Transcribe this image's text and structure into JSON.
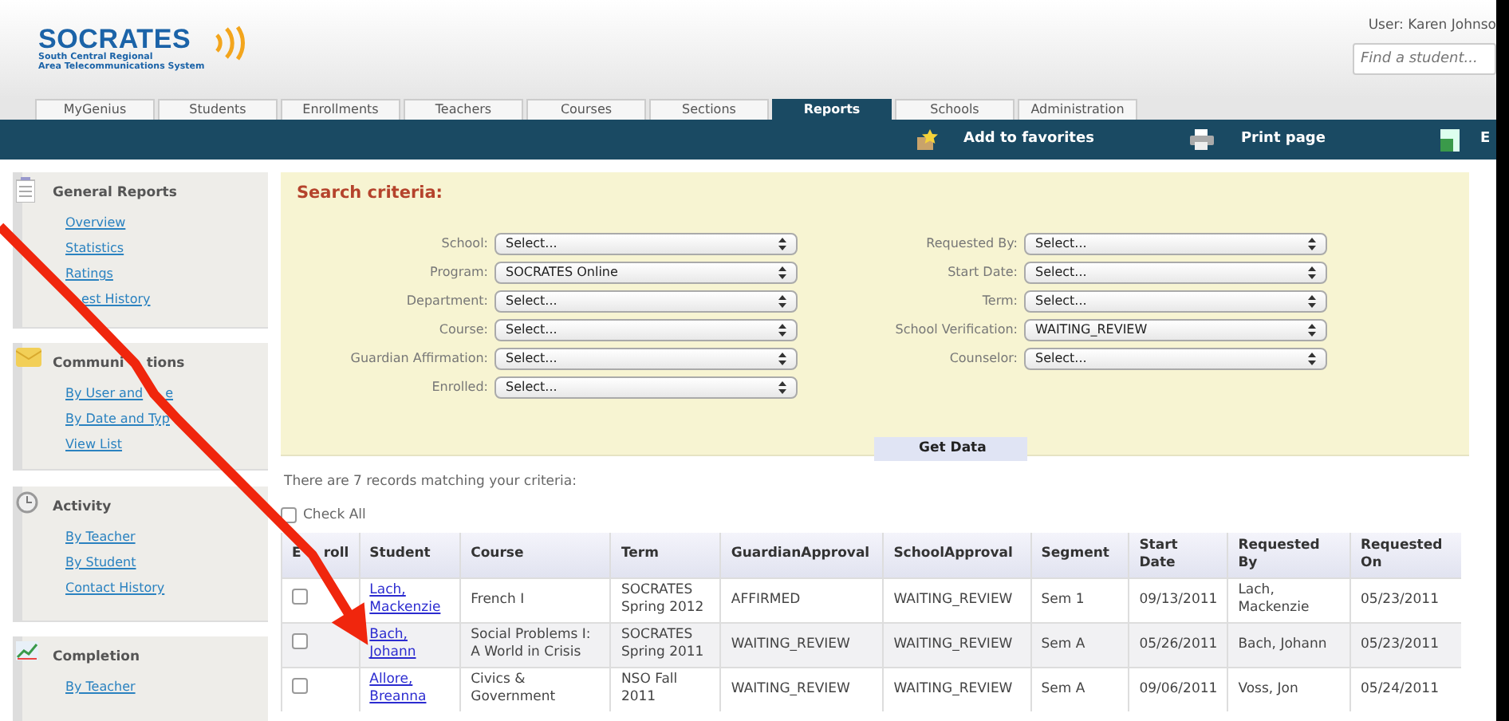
{
  "header": {
    "logo": {
      "name": "SOCRATES",
      "subtitle": [
        "South Central Regional",
        "Area Telecommunications System"
      ]
    },
    "user": "User: Karen Johnso",
    "search": {
      "placeholder": "Find a student..."
    }
  },
  "tabs": [
    {
      "label": "MyGenius",
      "selected": false
    },
    {
      "label": "Students",
      "selected": false
    },
    {
      "label": "Enrollments",
      "selected": false
    },
    {
      "label": "Teachers",
      "selected": false
    },
    {
      "label": "Courses",
      "selected": false
    },
    {
      "label": "Sections",
      "selected": false
    },
    {
      "label": "Reports",
      "selected": true
    },
    {
      "label": "Schools",
      "selected": false
    },
    {
      "label": "Administration",
      "selected": false
    }
  ],
  "toolbar": [
    {
      "kind": "favorites",
      "label": "Add to favorites"
    },
    {
      "kind": "print",
      "label": "Print page"
    },
    {
      "kind": "export",
      "label": "E"
    }
  ],
  "sidebar": [
    {
      "kind": "list",
      "title": {
        "parts": [
          "General Reports"
        ]
      },
      "links": [
        {
          "parts": [
            "Overview"
          ]
        },
        {
          "parts": [
            "Statistics"
          ]
        },
        {
          "parts": [
            "Ratings"
          ]
        },
        {
          "parts": [
            "est History"
          ],
          "covered_start": true
        }
      ]
    },
    {
      "kind": "mail",
      "title": {
        "parts": [
          "Communi",
          "tions"
        ]
      },
      "links": [
        {
          "parts": [
            "By User and",
            "e"
          ]
        },
        {
          "parts": [
            "By Date and Typ"
          ],
          "covered_end": true
        },
        {
          "parts": [
            "View List"
          ]
        }
      ]
    },
    {
      "kind": "clock",
      "title": {
        "parts": [
          "Activity"
        ]
      },
      "links": [
        {
          "parts": [
            "By Teacher"
          ]
        },
        {
          "parts": [
            "By Student"
          ]
        },
        {
          "parts": [
            "Contact History"
          ]
        }
      ]
    },
    {
      "kind": "chart",
      "title": {
        "parts": [
          "Completion"
        ]
      },
      "links": [
        {
          "parts": [
            "By Teacher"
          ]
        }
      ]
    }
  ],
  "search_criteria": {
    "title": "Search criteria:",
    "left": [
      {
        "label": "School:",
        "value": "Select..."
      },
      {
        "label": "Program:",
        "value": "SOCRATES Online"
      },
      {
        "label": "Department:",
        "value": "Select..."
      },
      {
        "label": "Course:",
        "value": "Select..."
      },
      {
        "label": "Guardian Affirmation:",
        "value": "Select..."
      },
      {
        "label": "Enrolled:",
        "value": "Select..."
      }
    ],
    "right": [
      {
        "label": "Requested By:",
        "value": "Select..."
      },
      {
        "label": "Start Date:",
        "value": "Select..."
      },
      {
        "label": "Term:",
        "value": "Select..."
      },
      {
        "label": "School Verification:",
        "value": "WAITING_REVIEW"
      },
      {
        "label": "Counselor:",
        "value": "Select..."
      }
    ],
    "button": "Get Data"
  },
  "results": {
    "summary": "There are 7 records matching your criteria:",
    "check_all": {
      "label": "Check All",
      "checked": false
    },
    "select_column": {
      "parts": [
        "E",
        "roll"
      ]
    },
    "columns": [
      "Student",
      "Course",
      "Term",
      "GuardianApproval",
      "SchoolApproval",
      "Segment",
      "Start Date",
      "Requested By",
      "Requested On"
    ],
    "rows": [
      {
        "checked": false,
        "cells": [
          "Lach, Mackenzie",
          "French I",
          "SOCRATES Spring 2012",
          "AFFIRMED",
          "WAITING_REVIEW",
          "Sem 1",
          "09/13/2011",
          "Lach, Mackenzie",
          "05/23/2011"
        ]
      },
      {
        "checked": false,
        "cells": [
          "Bach, Johann",
          "Social Problems I: A World in Crisis",
          "SOCRATES Spring 2011",
          "WAITING_REVIEW",
          "WAITING_REVIEW",
          "Sem A",
          "05/26/2011",
          "Bach, Johann",
          "05/23/2011"
        ]
      },
      {
        "checked": false,
        "cells": [
          "Allore, Breanna",
          "Civics & Government",
          "NSO Fall 2011",
          "WAITING_REVIEW",
          "WAITING_REVIEW",
          "Sem A",
          "09/06/2011",
          "Voss, Jon",
          "05/24/2011"
        ]
      }
    ]
  }
}
